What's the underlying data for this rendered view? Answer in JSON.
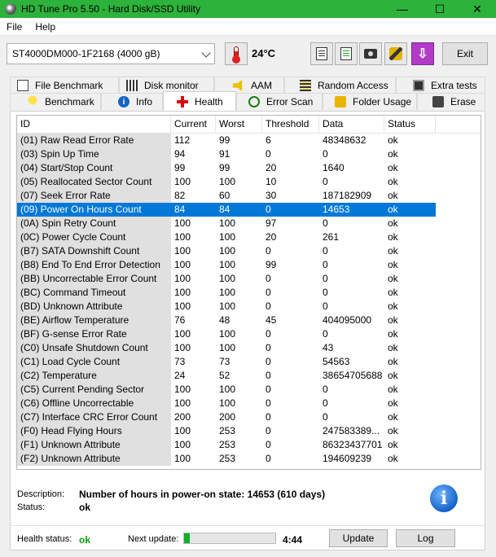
{
  "window": {
    "title": "HD Tune Pro 5.50 - Hard Disk/SSD Utility",
    "min": "—",
    "max": "☐",
    "close": "✕"
  },
  "menu": {
    "file": "File",
    "help": "Help"
  },
  "toolbar": {
    "drive": "ST4000DM000-1F2168 (4000 gB)",
    "temperature": "24°C",
    "exit": "Exit"
  },
  "tabs_top": [
    {
      "label": "File Benchmark",
      "icon": "file-icon"
    },
    {
      "label": "Disk monitor",
      "icon": "disk-monitor-icon"
    },
    {
      "label": "AAM",
      "icon": "speaker-icon"
    },
    {
      "label": "Random Access",
      "icon": "random-access-icon"
    },
    {
      "label": "Extra tests",
      "icon": "extra-tests-icon"
    }
  ],
  "tabs_bottom": [
    {
      "label": "Benchmark",
      "icon": "lightbulb-icon"
    },
    {
      "label": "Info",
      "icon": "info-icon"
    },
    {
      "label": "Health",
      "icon": "health-cross-icon",
      "active": true
    },
    {
      "label": "Error Scan",
      "icon": "magnifier-icon"
    },
    {
      "label": "Folder Usage",
      "icon": "folder-icon"
    },
    {
      "label": "Erase",
      "icon": "erase-icon"
    }
  ],
  "table": {
    "headers": [
      "ID",
      "Current",
      "Worst",
      "Threshold",
      "Data",
      "Status"
    ],
    "selected_index": 5,
    "rows": [
      [
        "(01) Raw Read Error Rate",
        "112",
        "99",
        "6",
        "48348632",
        "ok"
      ],
      [
        "(03) Spin Up Time",
        "94",
        "91",
        "0",
        "0",
        "ok"
      ],
      [
        "(04) Start/Stop Count",
        "99",
        "99",
        "20",
        "1640",
        "ok"
      ],
      [
        "(05) Reallocated Sector Count",
        "100",
        "100",
        "10",
        "0",
        "ok"
      ],
      [
        "(07) Seek Error Rate",
        "82",
        "60",
        "30",
        "187182909",
        "ok"
      ],
      [
        "(09) Power On Hours Count",
        "84",
        "84",
        "0",
        "14653",
        "ok"
      ],
      [
        "(0A) Spin Retry Count",
        "100",
        "100",
        "97",
        "0",
        "ok"
      ],
      [
        "(0C) Power Cycle Count",
        "100",
        "100",
        "20",
        "261",
        "ok"
      ],
      [
        "(B7) SATA Downshift Count",
        "100",
        "100",
        "0",
        "0",
        "ok"
      ],
      [
        "(B8) End To End Error Detection",
        "100",
        "100",
        "99",
        "0",
        "ok"
      ],
      [
        "(BB) Uncorrectable Error Count",
        "100",
        "100",
        "0",
        "0",
        "ok"
      ],
      [
        "(BC) Command Timeout",
        "100",
        "100",
        "0",
        "0",
        "ok"
      ],
      [
        "(BD) Unknown Attribute",
        "100",
        "100",
        "0",
        "0",
        "ok"
      ],
      [
        "(BE) Airflow Temperature",
        "76",
        "48",
        "45",
        "404095000",
        "ok"
      ],
      [
        "(BF) G-sense Error Rate",
        "100",
        "100",
        "0",
        "0",
        "ok"
      ],
      [
        "(C0) Unsafe Shutdown Count",
        "100",
        "100",
        "0",
        "43",
        "ok"
      ],
      [
        "(C1) Load Cycle Count",
        "73",
        "73",
        "0",
        "54563",
        "ok"
      ],
      [
        "(C2) Temperature",
        "24",
        "52",
        "0",
        "38654705688",
        "ok"
      ],
      [
        "(C5) Current Pending Sector",
        "100",
        "100",
        "0",
        "0",
        "ok"
      ],
      [
        "(C6) Offline Uncorrectable",
        "100",
        "100",
        "0",
        "0",
        "ok"
      ],
      [
        "(C7) Interface CRC Error Count",
        "200",
        "200",
        "0",
        "0",
        "ok"
      ],
      [
        "(F0) Head Flying Hours",
        "100",
        "253",
        "0",
        "247583389...",
        "ok"
      ],
      [
        "(F1) Unknown Attribute",
        "100",
        "253",
        "0",
        "86323437701",
        "ok"
      ],
      [
        "(F2) Unknown Attribute",
        "100",
        "253",
        "0",
        "194609239",
        "ok"
      ]
    ]
  },
  "description": {
    "desc_label": "Description:",
    "desc_value": "Number of hours in power-on state: 14653 (610 days)",
    "status_label": "Status:",
    "status_value": "ok"
  },
  "status_bar": {
    "health_label": "Health status:",
    "health_value": "ok",
    "next_update_label": "Next update:",
    "progress_percent": 6,
    "time": "4:44",
    "update_button": "Update",
    "log_button": "Log"
  },
  "colors": {
    "titlebar": "#2db23b",
    "selection": "#0078d7",
    "ok_green": "#0b9a0b",
    "progress": "#06b025"
  }
}
